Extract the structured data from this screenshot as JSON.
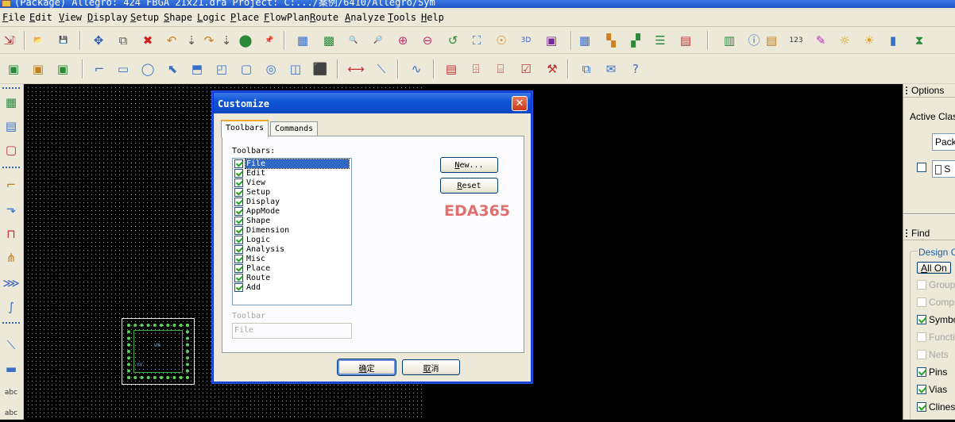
{
  "window": {
    "title": "(Package) Allegro: 424 FBGA 21x21.dra  Project: C:.../案例/6410/Allegro/Sym"
  },
  "menu": [
    "File",
    "Edit",
    "View",
    "Display",
    "Setup",
    "Shape",
    "Logic",
    "Place",
    "FlowPlan",
    "Route",
    "Analyze",
    "Tools",
    "Help"
  ],
  "toolbar1": {
    "icons": [
      {
        "name": "new-file-icon",
        "glyph": "🗋",
        "color": "#3a6fc8"
      },
      {
        "name": "open-folder-icon",
        "glyph": "📂",
        "color": "#d8a420"
      },
      {
        "name": "save-icon",
        "glyph": "💾",
        "color": "#3a5fa0"
      },
      {
        "name": "move-icon",
        "glyph": "✥",
        "color": "#2a57b8"
      },
      {
        "name": "copy-icon",
        "glyph": "⧉",
        "color": "#555"
      },
      {
        "name": "delete-icon",
        "glyph": "✖",
        "color": "#d02020"
      },
      {
        "name": "undo-icon",
        "glyph": "↶",
        "color": "#d0801a"
      },
      {
        "name": "undo-down-icon",
        "glyph": "⇣",
        "color": "#555"
      },
      {
        "name": "redo-icon",
        "glyph": "↷",
        "color": "#d0801a"
      },
      {
        "name": "redo-down-icon",
        "glyph": "⇣",
        "color": "#555"
      },
      {
        "name": "shape-icon",
        "glyph": "⬤",
        "color": "#2a8a3a"
      },
      {
        "name": "pin-icon",
        "glyph": "📌",
        "color": "#2a8a3a"
      },
      {
        "name": "grid-icon",
        "glyph": "▦",
        "color": "#3a6fc8"
      },
      {
        "name": "zoom-fit-icon",
        "glyph": "▩",
        "color": "#2a8a3a"
      },
      {
        "name": "zoom-points-icon",
        "glyph": "🔍",
        "color": "#555"
      },
      {
        "name": "zoom-icon",
        "glyph": "🔎",
        "color": "#c03070"
      },
      {
        "name": "zoom-in-icon",
        "glyph": "⊕",
        "color": "#c03070"
      },
      {
        "name": "zoom-out-icon",
        "glyph": "⊖",
        "color": "#c03070"
      },
      {
        "name": "zoom-previous-icon",
        "glyph": "↺",
        "color": "#2a8a3a"
      },
      {
        "name": "zoom-world-icon",
        "glyph": "⛶",
        "color": "#3a6fc8"
      },
      {
        "name": "redraw-icon",
        "glyph": "☉",
        "color": "#e08020"
      },
      {
        "name": "3d-view-icon",
        "glyph": "3D",
        "color": "#3a5fc0"
      },
      {
        "name": "flip-icon",
        "glyph": "▣",
        "color": "#7a2a9a"
      },
      {
        "name": "color-grid-icon",
        "glyph": "▦",
        "color": "#3a6fc8"
      },
      {
        "name": "color-palette-icon",
        "glyph": "▚",
        "color": "#d08020"
      },
      {
        "name": "layers-icon",
        "glyph": "▞",
        "color": "#2a8a3a"
      },
      {
        "name": "stack-icon",
        "glyph": "☰",
        "color": "#2a8a3a"
      },
      {
        "name": "ecm-icon",
        "glyph": "▤",
        "color": "#c03030"
      },
      {
        "name": "matrix-icon",
        "glyph": "▥",
        "color": "#2a8a3a"
      },
      {
        "name": "info-icon",
        "glyph": "ⓘ",
        "color": "#3a6fc8"
      },
      {
        "name": "report-icon",
        "glyph": "▤",
        "color": "#c08020"
      },
      {
        "name": "measure-icon",
        "glyph": "123",
        "color": "#333"
      },
      {
        "name": "highlight-icon",
        "glyph": "✎",
        "color": "#c030c0"
      },
      {
        "name": "light-icon",
        "glyph": "☼",
        "color": "#e0a020"
      },
      {
        "name": "dehighlight-icon",
        "glyph": "☀",
        "color": "#e0a020"
      },
      {
        "name": "stats-icon",
        "glyph": "▮",
        "color": "#3a6fc8"
      },
      {
        "name": "hourglass-icon",
        "glyph": "⧗",
        "color": "#2a8a3a"
      },
      {
        "name": "export-icon",
        "glyph": "⇲",
        "color": "#c03030"
      }
    ]
  },
  "toolbar2": {
    "icons": [
      {
        "name": "app-mode-general-icon",
        "glyph": "▣",
        "color": "#2a8a3a"
      },
      {
        "name": "app-mode-etch-icon",
        "glyph": "▣",
        "color": "#c08020"
      },
      {
        "name": "app-mode-placement-icon",
        "glyph": "▣",
        "color": "#2a8a3a"
      },
      {
        "name": "add-line-icon",
        "glyph": "⌐",
        "color": "#3a6fc8"
      },
      {
        "name": "add-rect-icon",
        "glyph": "▭",
        "color": "#3a6fc8"
      },
      {
        "name": "add-circle-icon",
        "glyph": "◯",
        "color": "#3a6fc8"
      },
      {
        "name": "select-icon",
        "glyph": "⬉",
        "color": "#3a6fc8"
      },
      {
        "name": "edit-boundary-icon",
        "glyph": "⬒",
        "color": "#3a6fc8"
      },
      {
        "name": "shape-void-icon",
        "glyph": "◰",
        "color": "#3a6fc8"
      },
      {
        "name": "shape-rect-icon",
        "glyph": "▢",
        "color": "#3a6fc8"
      },
      {
        "name": "shape-circle-icon",
        "glyph": "◎",
        "color": "#3a6fc8"
      },
      {
        "name": "shape-merge-icon",
        "glyph": "◫",
        "color": "#3a6fc8"
      },
      {
        "name": "pin-add-icon",
        "glyph": "⬛",
        "color": "#c03030"
      },
      {
        "name": "dimension-icon",
        "glyph": "⟷",
        "color": "#c03030"
      },
      {
        "name": "add-diagonal-icon",
        "glyph": "⟍",
        "color": "#3a6fc8"
      },
      {
        "name": "add-connect-icon",
        "glyph": "∿",
        "color": "#3a6fc8"
      },
      {
        "name": "report-list-icon",
        "glyph": "▤",
        "color": "#c03030"
      },
      {
        "name": "book-icon",
        "glyph": "⌹",
        "color": "#c03030"
      },
      {
        "name": "net-icon",
        "glyph": "⌸",
        "color": "#c03030"
      },
      {
        "name": "check-icon",
        "glyph": "☑",
        "color": "#c03030"
      },
      {
        "name": "tools-icon",
        "glyph": "⚒",
        "color": "#c03030"
      },
      {
        "name": "windows-icon",
        "glyph": "⧉",
        "color": "#3a6fc8"
      },
      {
        "name": "mail-icon",
        "glyph": "✉",
        "color": "#3a6fc8"
      },
      {
        "name": "help-icon",
        "glyph": "?",
        "color": "#3a6fc8"
      }
    ]
  },
  "left_toolbar": {
    "icons": [
      {
        "name": "place-manual-icon",
        "glyph": "▦",
        "color": "#2a8a3a"
      },
      {
        "name": "component-icon",
        "glyph": "▤",
        "color": "#3a6fc8"
      },
      {
        "name": "pin-swap-icon",
        "glyph": "▢",
        "color": "#c03030"
      },
      {
        "name": "route-add-icon",
        "glyph": "⌐",
        "color": "#c08020"
      },
      {
        "name": "route-slide-icon",
        "glyph": "⬎",
        "color": "#3a6fc8"
      },
      {
        "name": "route-delay-icon",
        "glyph": "⊓",
        "color": "#c03030"
      },
      {
        "name": "route-fanout-icon",
        "glyph": "⋔",
        "color": "#c08020"
      },
      {
        "name": "route-bundle-icon",
        "glyph": "⋙",
        "color": "#3a5fc0"
      },
      {
        "name": "route-phase-icon",
        "glyph": "∫",
        "color": "#3a6fc8"
      },
      {
        "name": "add-line-icon",
        "glyph": "⟍",
        "color": "#3a6fc8"
      },
      {
        "name": "add-shape-rect-icon",
        "glyph": "▬",
        "color": "#3a6fc8"
      },
      {
        "name": "add-text-icon",
        "glyph": "abc",
        "color": "#333"
      },
      {
        "name": "edit-text-icon",
        "glyph": "abc",
        "color": "#333"
      }
    ]
  },
  "canvas": {
    "package_labels": [
      "U6",
      "YY"
    ],
    "colors": {
      "background": "#000000",
      "grid": "#9a9a9a",
      "pads": "#5fd35f"
    }
  },
  "options_panel": {
    "header": "Options",
    "active_class_label": "Active Class",
    "class_value": "Pack",
    "subclass_value": "S"
  },
  "find_panel": {
    "header": "Find",
    "design_objects_label": "Design Ob",
    "all_on": "All On",
    "items": [
      {
        "label": "Groups",
        "checked": false,
        "enabled": false
      },
      {
        "label": "Comps",
        "checked": false,
        "enabled": false
      },
      {
        "label": "Symbol",
        "checked": true,
        "enabled": true
      },
      {
        "label": "Functio",
        "checked": false,
        "enabled": false
      },
      {
        "label": "Nets",
        "checked": false,
        "enabled": false
      },
      {
        "label": "Pins",
        "checked": true,
        "enabled": true
      },
      {
        "label": "Vias",
        "checked": true,
        "enabled": true
      },
      {
        "label": "Clines",
        "checked": true,
        "enabled": true
      }
    ]
  },
  "dialog": {
    "title": "Customize",
    "tabs": [
      "Toolbars",
      "Commands"
    ],
    "toolbars_label": "Toolbars",
    "toolbar_items": [
      {
        "label": "File",
        "checked": true,
        "selected": true
      },
      {
        "label": "Edit",
        "checked": true
      },
      {
        "label": "View",
        "checked": true
      },
      {
        "label": "Setup",
        "checked": true
      },
      {
        "label": "Display",
        "checked": true
      },
      {
        "label": "AppMode",
        "checked": true
      },
      {
        "label": "Shape",
        "checked": true
      },
      {
        "label": "Dimension",
        "checked": true
      },
      {
        "label": "Logic",
        "checked": true
      },
      {
        "label": "Analysis",
        "checked": true
      },
      {
        "label": "Misc",
        "checked": true
      },
      {
        "label": "Place",
        "checked": true
      },
      {
        "label": "Route",
        "checked": true
      },
      {
        "label": "Add",
        "checked": true
      }
    ],
    "new_button": "New...",
    "reset_button": "Reset",
    "toolbar_name_label": "Toolbar",
    "toolbar_name_value": "File",
    "ok_button": "确定",
    "cancel_button": "取消",
    "watermark": "EDA365",
    "close_glyph": "✕"
  }
}
